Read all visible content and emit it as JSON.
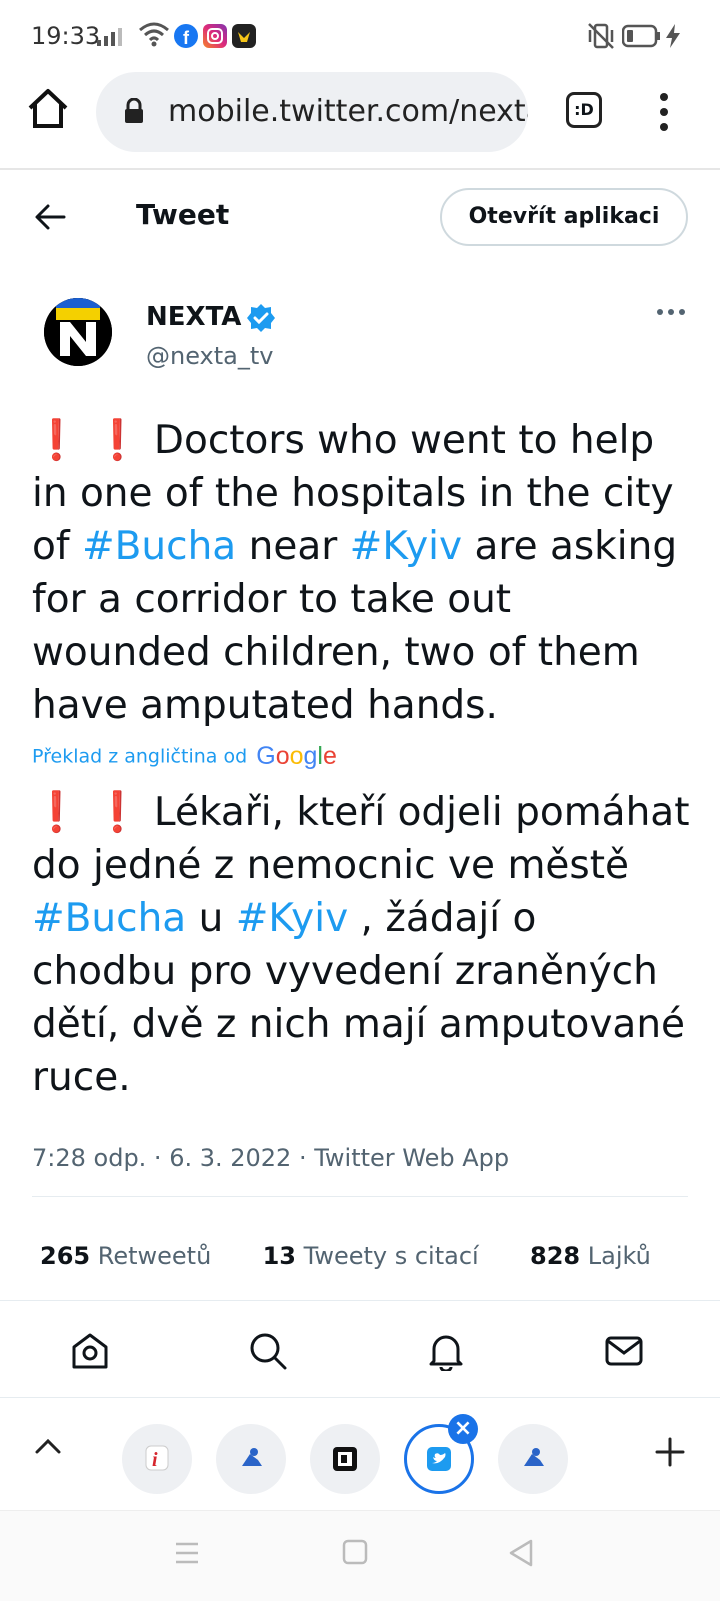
{
  "status_bar": {
    "time": "19:33",
    "icons": [
      "signal-icon",
      "wifi-icon",
      "facebook-icon",
      "instagram-icon",
      "app-icon",
      "vibrate-off-icon",
      "battery-icon",
      "charging-icon"
    ]
  },
  "browser": {
    "url": "mobile.twitter.com/nexta_tv",
    "tab_count_label": ":D"
  },
  "header": {
    "title": "Tweet",
    "open_app_label": "Otevřít aplikaci"
  },
  "author": {
    "name": "NEXTA",
    "handle": "@nexta_tv",
    "avatar_letter": "N"
  },
  "tweet": {
    "original": {
      "prefix": "❗ ❗ Doctors who went to help in one of the hospitals in the city of ",
      "tag1": "#Bucha",
      "mid": " near ",
      "tag2": "#Kyiv",
      "suffix": " are asking for a corridor to take out wounded children, two of them have amputated hands."
    },
    "translation_label": "Překlad z angličtina od",
    "translation_provider": [
      "G",
      "o",
      "o",
      "g",
      "l",
      "e"
    ],
    "translated": {
      "prefix": "❗ ❗ Lékaři, kteří odjeli pomáhat do jedné z nemocnic ve městě ",
      "tag1": "#Bucha",
      "mid": " u ",
      "tag2": "#Kyiv",
      "suffix": " , žádají o chodbu pro vyvedení zraněných dětí, dvě z nich mají amputované ruce."
    },
    "meta": "7:28 odp. · 6. 3. 2022 · Twitter Web App"
  },
  "stats": {
    "retweets_count": "265",
    "retweets_label": "Retweetů",
    "quotes_count": "13",
    "quotes_label": "Tweety s citací",
    "likes_count": "828",
    "likes_label": "Lajků"
  },
  "colors": {
    "accent": "#1d9bf0",
    "text": "#0f1419",
    "muted": "#536471",
    "alert": "#d6262e",
    "tab_active": "#1a73e8"
  }
}
